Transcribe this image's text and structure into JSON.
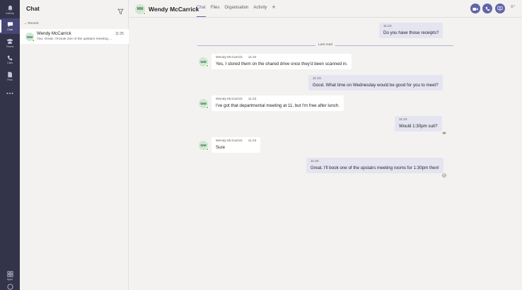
{
  "rail": {
    "items": [
      {
        "label": "Activity",
        "icon": "bell-icon"
      },
      {
        "label": "Chat",
        "icon": "chat-icon"
      },
      {
        "label": "Teams",
        "icon": "teams-icon"
      },
      {
        "label": "Calls",
        "icon": "phone-icon"
      },
      {
        "label": "Files",
        "icon": "file-icon"
      },
      {
        "label": "Apps",
        "icon": "apps-icon"
      }
    ]
  },
  "chatlist": {
    "title": "Chat",
    "section": "Recent",
    "rows": [
      {
        "initials": "WM",
        "name": "Wendy McCarrick",
        "time": "11:25",
        "preview": "You: Great. I'll book one of the upstairs meeting ..."
      }
    ]
  },
  "header": {
    "initials": "WM",
    "name": "Wendy McCarrick",
    "tabs": [
      "Chat",
      "Files",
      "Organisation",
      "Activity"
    ],
    "add_tab": "+",
    "more": "≡⁺"
  },
  "messages": [
    {
      "dir": "out",
      "time": "11:22",
      "text": "Do you have those receipts?"
    },
    {
      "dir": "in",
      "initials": "WM",
      "sender": "Wendy McCarrick",
      "time": "11:22",
      "text": "Yes, I stored them on the shared drive once they'd been scanned in."
    },
    {
      "dir": "out",
      "time": "11:23",
      "text": "Good. What time on Wednesday would be good for you to meet?"
    },
    {
      "dir": "in",
      "initials": "WM",
      "sender": "Wendy McCarrick",
      "time": "11:24",
      "text": "I've got that departmental meeting at 11, but I'm free after lunch."
    },
    {
      "dir": "out",
      "time": "11:24",
      "text": "Would 1:30pm suit?"
    },
    {
      "dir": "in",
      "initials": "WM",
      "sender": "Wendy McCarrick",
      "time": "11:24",
      "text": "Sure"
    },
    {
      "dir": "out",
      "time": "11:25",
      "text": "Great. I'll book one of the upstairs meeting rooms for 1:30pm then!"
    }
  ],
  "last_read_label": "Last read",
  "colors": {
    "rail": "#33344a",
    "accent": "#6264a7",
    "outgoing": "#e5e5f1",
    "presence": "#6bb700"
  }
}
